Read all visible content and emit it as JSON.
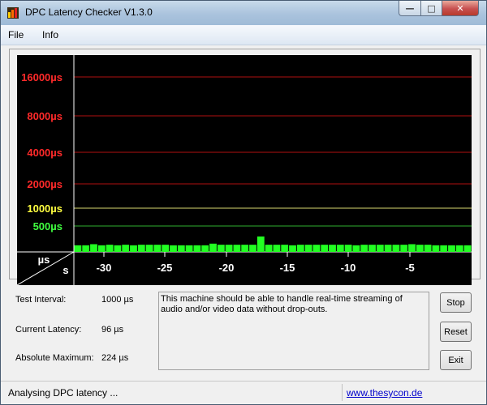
{
  "window": {
    "title": "DPC Latency Checker V1.3.0",
    "minimize_glyph": "—",
    "maximize_glyph": "□",
    "close_glyph": "✕"
  },
  "menu": {
    "items": [
      "File",
      "Info"
    ]
  },
  "chart_data": {
    "type": "bar",
    "ylabels": [
      {
        "text": "16000µs",
        "color": "#ff2a2a"
      },
      {
        "text": "8000µs",
        "color": "#ff2a2a"
      },
      {
        "text": "4000µs",
        "color": "#ff2a2a"
      },
      {
        "text": "2000µs",
        "color": "#ff2a2a"
      },
      {
        "text": "1000µs",
        "color": "#ffff40"
      },
      {
        "text": "500µs",
        "color": "#40ff40"
      }
    ],
    "corner_top": "µs",
    "corner_bottom": "s",
    "x_ticks": [
      "-30",
      "-25",
      "-20",
      "-15",
      "-10",
      "-5"
    ],
    "bar_color": "#22ff22",
    "values_us": [
      96,
      96,
      112,
      96,
      104,
      96,
      104,
      96,
      104,
      104,
      104,
      104,
      96,
      96,
      96,
      96,
      96,
      120,
      104,
      104,
      104,
      104,
      104,
      224,
      104,
      104,
      104,
      96,
      104,
      104,
      104,
      104,
      104,
      104,
      104,
      96,
      104,
      104,
      104,
      104,
      104,
      104,
      112,
      104,
      104,
      96,
      96,
      96,
      96,
      96
    ]
  },
  "info": {
    "test_interval_label": "Test Interval:",
    "test_interval_value": "1000 µs",
    "current_latency_label": "Current Latency:",
    "current_latency_value": "96 µs",
    "absolute_max_label": "Absolute Maximum:",
    "absolute_max_value": "224 µs"
  },
  "message": "This machine should be able to handle real-time streaming of audio and/or video data without drop-outs.",
  "buttons": {
    "stop": "Stop",
    "reset": "Reset",
    "exit": "Exit"
  },
  "status": {
    "text": "Analysing DPC latency ...",
    "link": "www.thesycon.de"
  }
}
